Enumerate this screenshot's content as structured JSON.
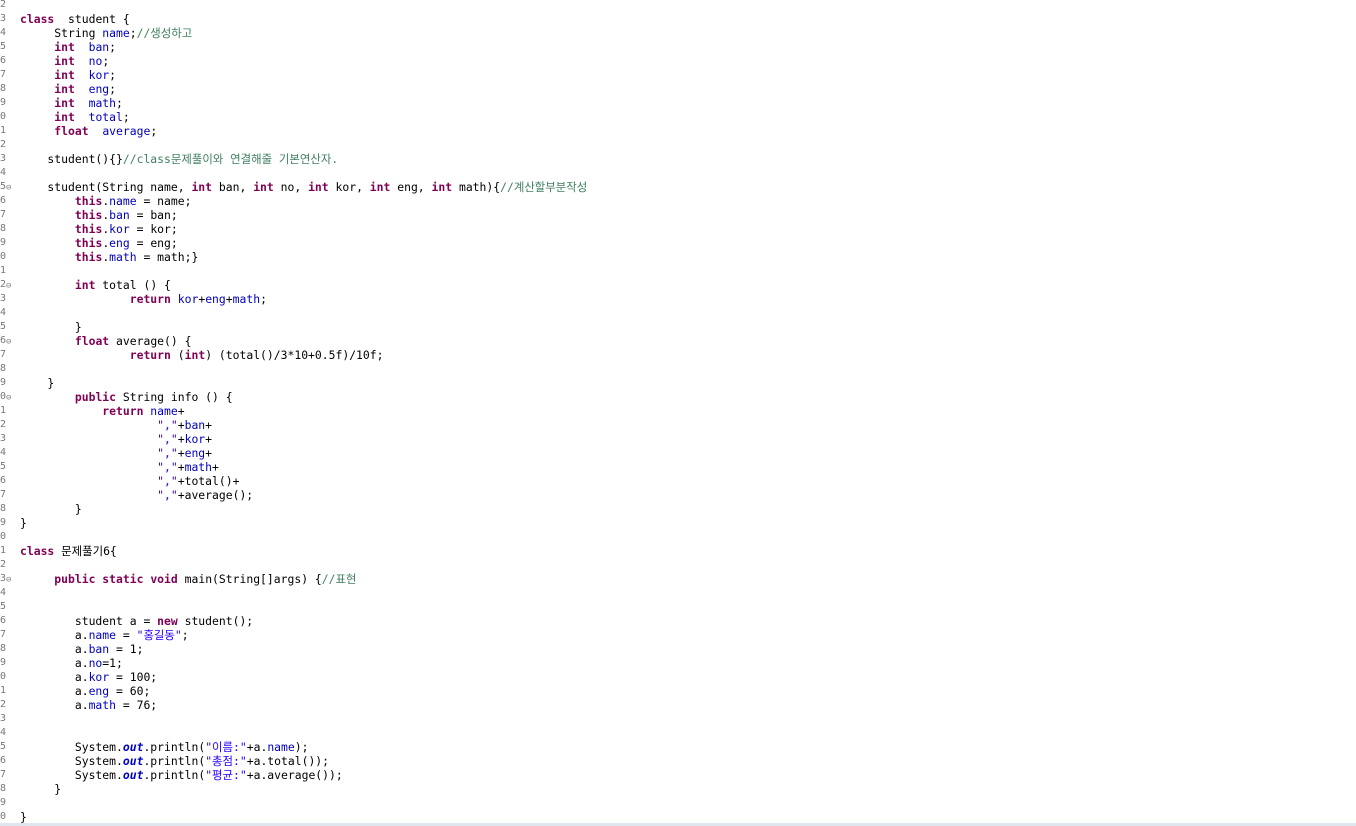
{
  "editor": {
    "lines": [
      {
        "n": "2",
        "t": []
      },
      {
        "n": "3",
        "t": [
          [
            "kw",
            "class"
          ],
          [
            "",
            "  student {"
          ]
        ]
      },
      {
        "n": "4",
        "t": [
          [
            "",
            "     String "
          ],
          [
            "fd",
            "name"
          ],
          [
            "",
            ";"
          ],
          [
            "cm",
            "//생성하고"
          ]
        ]
      },
      {
        "n": "5",
        "t": [
          [
            "",
            "     "
          ],
          [
            "kw",
            "int"
          ],
          [
            "",
            "  "
          ],
          [
            "fd",
            "ban"
          ],
          [
            "",
            ";"
          ]
        ]
      },
      {
        "n": "6",
        "t": [
          [
            "",
            "     "
          ],
          [
            "kw",
            "int"
          ],
          [
            "",
            "  "
          ],
          [
            "fd",
            "no"
          ],
          [
            "",
            ";"
          ]
        ]
      },
      {
        "n": "7",
        "t": [
          [
            "",
            "     "
          ],
          [
            "kw",
            "int"
          ],
          [
            "",
            "  "
          ],
          [
            "fd",
            "kor"
          ],
          [
            "",
            ";"
          ]
        ]
      },
      {
        "n": "8",
        "t": [
          [
            "",
            "     "
          ],
          [
            "kw",
            "int"
          ],
          [
            "",
            "  "
          ],
          [
            "fd",
            "eng"
          ],
          [
            "",
            ";"
          ]
        ]
      },
      {
        "n": "9",
        "t": [
          [
            "",
            "     "
          ],
          [
            "kw",
            "int"
          ],
          [
            "",
            "  "
          ],
          [
            "fd",
            "math"
          ],
          [
            "",
            ";"
          ]
        ]
      },
      {
        "n": "0",
        "t": [
          [
            "",
            "     "
          ],
          [
            "kw",
            "int"
          ],
          [
            "",
            "  "
          ],
          [
            "fd",
            "total"
          ],
          [
            "",
            ";"
          ]
        ]
      },
      {
        "n": "1",
        "t": [
          [
            "",
            "     "
          ],
          [
            "kw",
            "float"
          ],
          [
            "",
            "  "
          ],
          [
            "fd",
            "average"
          ],
          [
            "",
            ";"
          ]
        ]
      },
      {
        "n": "2",
        "t": []
      },
      {
        "n": "3",
        "t": [
          [
            "",
            "    student(){}"
          ],
          [
            "cm",
            "//class문제풀이와 연결해줄 기본연산자."
          ]
        ]
      },
      {
        "n": "4",
        "t": []
      },
      {
        "n": "5",
        "f": true,
        "t": [
          [
            "",
            "    student(String name, "
          ],
          [
            "kw",
            "int"
          ],
          [
            "",
            " ban, "
          ],
          [
            "kw",
            "int"
          ],
          [
            "",
            " no, "
          ],
          [
            "kw",
            "int"
          ],
          [
            "",
            " kor, "
          ],
          [
            "kw",
            "int"
          ],
          [
            "",
            " eng, "
          ],
          [
            "kw",
            "int"
          ],
          [
            "",
            " math){"
          ],
          [
            "cm",
            "//계산할부분작성"
          ]
        ]
      },
      {
        "n": "6",
        "t": [
          [
            "",
            "        "
          ],
          [
            "kw",
            "this"
          ],
          [
            "",
            "."
          ],
          [
            "fd",
            "name"
          ],
          [
            "",
            " = name;"
          ]
        ]
      },
      {
        "n": "7",
        "t": [
          [
            "",
            "        "
          ],
          [
            "kw",
            "this"
          ],
          [
            "",
            "."
          ],
          [
            "fd",
            "ban"
          ],
          [
            "",
            " = ban;"
          ]
        ]
      },
      {
        "n": "8",
        "t": [
          [
            "",
            "        "
          ],
          [
            "kw",
            "this"
          ],
          [
            "",
            "."
          ],
          [
            "fd",
            "kor"
          ],
          [
            "",
            " = kor;"
          ]
        ]
      },
      {
        "n": "9",
        "t": [
          [
            "",
            "        "
          ],
          [
            "kw",
            "this"
          ],
          [
            "",
            "."
          ],
          [
            "fd",
            "eng"
          ],
          [
            "",
            " = eng;"
          ]
        ]
      },
      {
        "n": "0",
        "t": [
          [
            "",
            "        "
          ],
          [
            "kw",
            "this"
          ],
          [
            "",
            "."
          ],
          [
            "fd",
            "math"
          ],
          [
            "",
            " = math;}"
          ]
        ]
      },
      {
        "n": "1",
        "t": []
      },
      {
        "n": "2",
        "f": true,
        "t": [
          [
            "",
            "        "
          ],
          [
            "kw",
            "int"
          ],
          [
            "",
            " total () {"
          ]
        ]
      },
      {
        "n": "3",
        "t": [
          [
            "",
            "                "
          ],
          [
            "kw",
            "return"
          ],
          [
            "fd",
            " kor"
          ],
          [
            "",
            "+"
          ],
          [
            "fd",
            "eng"
          ],
          [
            "",
            "+"
          ],
          [
            "fd",
            "math"
          ],
          [
            "",
            ";"
          ]
        ]
      },
      {
        "n": "4",
        "t": []
      },
      {
        "n": "5",
        "t": [
          [
            "",
            "        }"
          ]
        ]
      },
      {
        "n": "6",
        "f": true,
        "t": [
          [
            "",
            "        "
          ],
          [
            "kw",
            "float"
          ],
          [
            "",
            " average() {"
          ]
        ]
      },
      {
        "n": "7",
        "t": [
          [
            "",
            "                "
          ],
          [
            "kw",
            "return"
          ],
          [
            "",
            " ("
          ],
          [
            "kw",
            "int"
          ],
          [
            "",
            ") (total()/3*10+0.5f)/10f;"
          ]
        ]
      },
      {
        "n": "8",
        "t": []
      },
      {
        "n": "9",
        "t": [
          [
            "",
            "    }"
          ]
        ]
      },
      {
        "n": "0",
        "f": true,
        "t": [
          [
            "",
            "        "
          ],
          [
            "kw",
            "public"
          ],
          [
            "",
            " String info () {"
          ]
        ]
      },
      {
        "n": "1",
        "t": [
          [
            "",
            "            "
          ],
          [
            "kw",
            "return"
          ],
          [
            "fd",
            " name"
          ],
          [
            "",
            "+"
          ]
        ]
      },
      {
        "n": "2",
        "t": [
          [
            "",
            "                    "
          ],
          [
            "st",
            "\",\""
          ],
          [
            "",
            "+"
          ],
          [
            "fd",
            "ban"
          ],
          [
            "",
            "+"
          ]
        ]
      },
      {
        "n": "3",
        "t": [
          [
            "",
            "                    "
          ],
          [
            "st",
            "\",\""
          ],
          [
            "",
            "+"
          ],
          [
            "fd",
            "kor"
          ],
          [
            "",
            "+"
          ]
        ]
      },
      {
        "n": "4",
        "t": [
          [
            "",
            "                    "
          ],
          [
            "st",
            "\",\""
          ],
          [
            "",
            "+"
          ],
          [
            "fd",
            "eng"
          ],
          [
            "",
            "+"
          ]
        ]
      },
      {
        "n": "5",
        "t": [
          [
            "",
            "                    "
          ],
          [
            "st",
            "\",\""
          ],
          [
            "",
            "+"
          ],
          [
            "fd",
            "math"
          ],
          [
            "",
            "+"
          ]
        ]
      },
      {
        "n": "6",
        "t": [
          [
            "",
            "                    "
          ],
          [
            "st",
            "\",\""
          ],
          [
            "",
            "+total()+"
          ]
        ]
      },
      {
        "n": "7",
        "t": [
          [
            "",
            "                    "
          ],
          [
            "st",
            "\",\""
          ],
          [
            "",
            "+average();"
          ]
        ]
      },
      {
        "n": "8",
        "t": [
          [
            "",
            "        }"
          ]
        ]
      },
      {
        "n": "9",
        "t": [
          [
            "",
            "}"
          ]
        ]
      },
      {
        "n": "0",
        "t": []
      },
      {
        "n": "1",
        "t": [
          [
            "kw",
            "class"
          ],
          [
            "",
            " 문제풀기6{"
          ]
        ]
      },
      {
        "n": "2",
        "t": []
      },
      {
        "n": "3",
        "f": true,
        "t": [
          [
            "",
            "     "
          ],
          [
            "kw",
            "public"
          ],
          [
            "kw",
            " static"
          ],
          [
            "kw",
            " void"
          ],
          [
            "",
            " main(String[]args) {"
          ],
          [
            "cm",
            "//표현"
          ]
        ]
      },
      {
        "n": "4",
        "t": []
      },
      {
        "n": "5",
        "t": []
      },
      {
        "n": "6",
        "t": [
          [
            "",
            "        student a = "
          ],
          [
            "kw",
            "new"
          ],
          [
            "",
            " student();"
          ]
        ]
      },
      {
        "n": "7",
        "t": [
          [
            "",
            "        a."
          ],
          [
            "fd",
            "name"
          ],
          [
            "",
            " = "
          ],
          [
            "st",
            "\"홍길동\""
          ],
          [
            "",
            ";"
          ]
        ]
      },
      {
        "n": "8",
        "t": [
          [
            "",
            "        a."
          ],
          [
            "fd",
            "ban"
          ],
          [
            "",
            " = 1;"
          ]
        ]
      },
      {
        "n": "9",
        "t": [
          [
            "",
            "        a."
          ],
          [
            "fd",
            "no"
          ],
          [
            "",
            "=1;"
          ]
        ]
      },
      {
        "n": "0",
        "t": [
          [
            "",
            "        a."
          ],
          [
            "fd",
            "kor"
          ],
          [
            "",
            " = 100;"
          ]
        ]
      },
      {
        "n": "1",
        "t": [
          [
            "",
            "        a."
          ],
          [
            "fd",
            "eng"
          ],
          [
            "",
            " = 60;"
          ]
        ]
      },
      {
        "n": "2",
        "t": [
          [
            "",
            "        a."
          ],
          [
            "fd",
            "math"
          ],
          [
            "",
            " = 76;"
          ]
        ]
      },
      {
        "n": "3",
        "t": []
      },
      {
        "n": "4",
        "t": []
      },
      {
        "n": "5",
        "t": [
          [
            "",
            "        System."
          ],
          [
            "sf",
            "out"
          ],
          [
            "",
            ".println("
          ],
          [
            "st",
            "\"이름:\""
          ],
          [
            "",
            "+a."
          ],
          [
            "fd",
            "name"
          ],
          [
            "",
            ");"
          ]
        ]
      },
      {
        "n": "6",
        "t": [
          [
            "",
            "        System."
          ],
          [
            "sf",
            "out"
          ],
          [
            "",
            ".println("
          ],
          [
            "st",
            "\"총점:\""
          ],
          [
            "",
            "+a.total());"
          ]
        ]
      },
      {
        "n": "7",
        "t": [
          [
            "",
            "        System."
          ],
          [
            "sf",
            "out"
          ],
          [
            "",
            ".println("
          ],
          [
            "st",
            "\"평균:\""
          ],
          [
            "",
            "+a.average());"
          ]
        ]
      },
      {
        "n": "8",
        "t": [
          [
            "",
            "     }"
          ]
        ]
      },
      {
        "n": "9",
        "t": []
      },
      {
        "n": "0",
        "t": [
          [
            "",
            "}"
          ]
        ]
      }
    ]
  }
}
